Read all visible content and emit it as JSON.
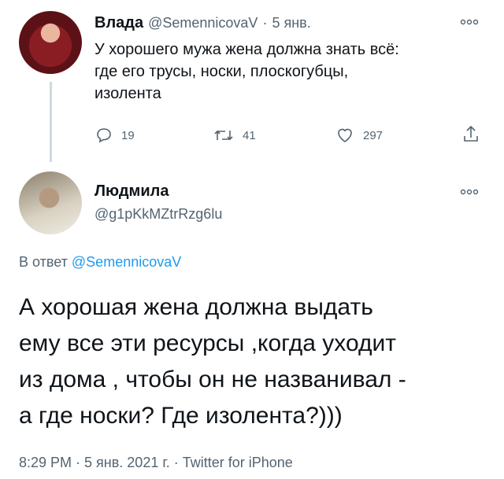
{
  "tweet1": {
    "name": "Влада",
    "handle": "@SemennicovaV",
    "sep": "·",
    "date": "5 янв.",
    "text_line1": "У хорошего мужа жена должна знать всё:",
    "text_line2": "где его трусы, носки, плоскогубцы,",
    "text_line3": "изолента",
    "replies": "19",
    "retweets": "41",
    "likes": "297"
  },
  "tweet2": {
    "name": "Людмила",
    "handle": "@g1pKkMZtrRzg6lu",
    "reply_prefix": "В ответ",
    "reply_handle": "@SemennicovaV",
    "text_line1": "А хорошая жена должна выдать",
    "text_line2": "ему все эти ресурсы ,когда уходит",
    "text_line3": "из дома , чтобы он не названивал -",
    "text_line4": "а где носки? Где изолента?)))",
    "footer": "8:29 PM · 5 янв. 2021 г. · Twitter for iPhone"
  },
  "icons": {
    "more": "more-icon",
    "reply": "reply-icon",
    "retweet": "retweet-icon",
    "like": "heart-icon",
    "share": "share-icon"
  }
}
